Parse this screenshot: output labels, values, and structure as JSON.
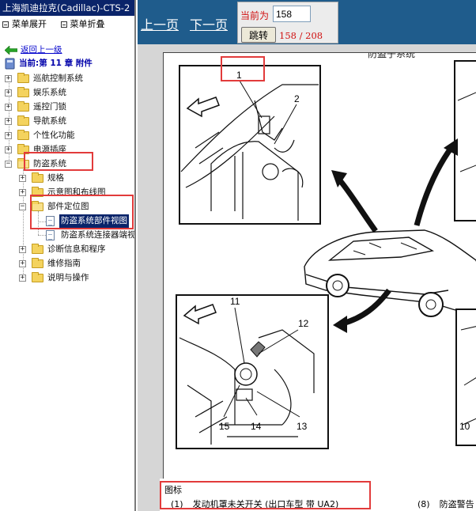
{
  "left": {
    "title": "上海凯迪拉克(Cadillac)-CTS-2",
    "menu": {
      "expand": "菜单展开",
      "collapse": "菜单折叠"
    },
    "back_link": "返回上一级",
    "current_chapter": "当前:第 11 章 附件",
    "tree": [
      {
        "label": "巡航控制系统"
      },
      {
        "label": "娱乐系统"
      },
      {
        "label": "遥控门锁"
      },
      {
        "label": "导航系统"
      },
      {
        "label": "个性化功能"
      },
      {
        "label": "电源插座"
      },
      {
        "label": "防盗系统"
      },
      {
        "label": "规格"
      },
      {
        "label": "示意图和布线图"
      },
      {
        "label": "部件定位图"
      },
      {
        "label": "防盗系统部件视图"
      },
      {
        "label": "防盗系统连接器端视"
      },
      {
        "label": "诊断信息和程序"
      },
      {
        "label": "维修指南"
      },
      {
        "label": "说明与操作"
      }
    ]
  },
  "nav": {
    "prev": "上一页",
    "next": "下一页",
    "current_label": "当前为",
    "page_value": "158",
    "jump_button": "跳转",
    "page_count": "158 / 208"
  },
  "document": {
    "section_title": "防盗子系统",
    "callouts": [
      "1",
      "2",
      "11",
      "12",
      "13",
      "14",
      "15",
      "10"
    ],
    "legend_header": "图标",
    "legend_1_num": "(1)",
    "legend_1_text": "发动机罩未关开关 (出口车型 带 UA2)",
    "legend_8_num": "(8)",
    "legend_8_text": "防盗警告"
  },
  "colors": {
    "title_bar": "#0a246a",
    "nav_bar": "#1f5c8c",
    "highlight_box": "#e23b3b",
    "page_count": "#d01010",
    "link": "#0000cc"
  }
}
